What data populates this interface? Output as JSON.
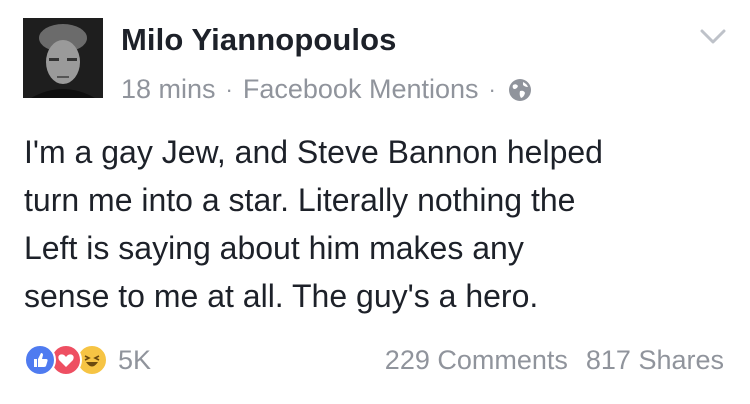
{
  "post": {
    "author": "Milo Yiannopoulos",
    "time": "18 mins",
    "separator": "·",
    "source": "Facebook Mentions",
    "privacy_icon": "globe-icon",
    "menu_icon": "chevron-down-icon",
    "text_lines": [
      "I'm a gay Jew, and Steve Bannon helped",
      "turn me into a star. Literally nothing the",
      "Left is saying about him makes any",
      "sense to me at all. The guy's a hero."
    ]
  },
  "footer": {
    "reactions": [
      "like-icon",
      "love-icon",
      "haha-icon"
    ],
    "reaction_count": "5K",
    "comments": "229 Comments",
    "shares": "817 Shares"
  },
  "colors": {
    "text": "#1d2129",
    "secondary": "#90949c",
    "like": "#4f7bf0",
    "love": "#ee4f62",
    "haha": "#f6c444"
  }
}
